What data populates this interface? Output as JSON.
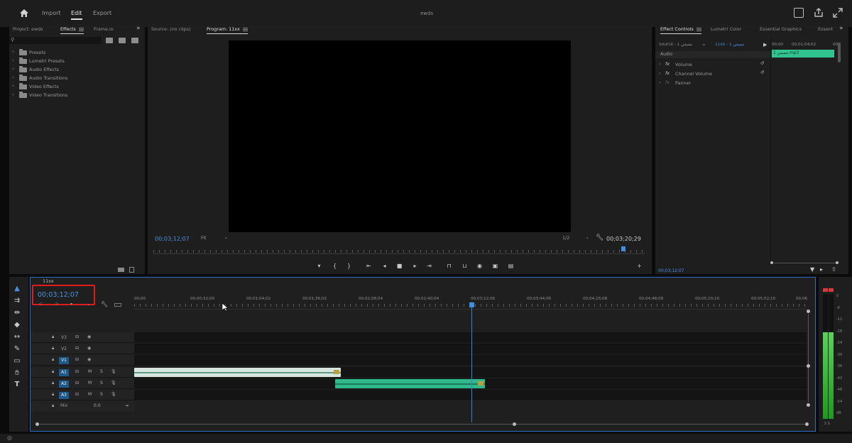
{
  "window": {
    "title": "ewds"
  },
  "menus": {
    "home_icon": "home-icon",
    "items": [
      "Import",
      "Edit",
      "Export"
    ],
    "active": "Edit"
  },
  "left_panel": {
    "tabs": [
      "Project: ewds",
      "Effects",
      "Frame.io"
    ],
    "active_tab": "Effects",
    "search_placeholder": "",
    "folders": [
      "Presets",
      "Lumetri Presets",
      "Audio Effects",
      "Audio Transitions",
      "Video Effects",
      "Video Transitions"
    ]
  },
  "monitor": {
    "tabs": [
      "Source: (no clips)",
      "Program: 11xx"
    ],
    "active_tab": "Program: 11xx",
    "timecode_current": "00;03;12;07",
    "fit_label": "Fit",
    "resolution": "1/2",
    "timecode_duration": "00;03;20;29"
  },
  "effect_controls": {
    "tabs": [
      "Effect Controls",
      "Lumetri Color",
      "Essential Graphics",
      "Essent"
    ],
    "active_tab": "Effect Controls",
    "source_label": "Source - 1 تیمپس",
    "sequence_label": "11xx - 1 تیمپس",
    "mini_tc": [
      "00;00",
      "00;01;04;02",
      "00;"
    ],
    "clip_name": "1 تیمپس.mp3",
    "section": "Audio",
    "effects": [
      "Volume",
      "Channel Volume",
      "Panner"
    ],
    "timecode": "00;03;12;07"
  },
  "timeline": {
    "sequence_name": "11xx",
    "timecode": "00;03;12;07",
    "ruler": [
      "00;00",
      "00;00;32;00",
      "00;01;04;02",
      "00;01;36;02",
      "00;02;08;04",
      "00;02;40;04",
      "00;03;12;06",
      "00;03;44;06",
      "00;04;16;08",
      "00;04;48;08",
      "00;05;20;10",
      "00;05;52;10",
      "00;06"
    ],
    "video_tracks": [
      "V3",
      "V2",
      "V1"
    ],
    "audio_tracks": [
      "A1",
      "A2",
      "A3"
    ],
    "mix": {
      "label": "Mix",
      "value": "0.0"
    },
    "playhead_fraction": 0.501,
    "clips": [
      {
        "track": "A1",
        "start": 0.0,
        "end": 0.307,
        "color": "#d8e6e0"
      },
      {
        "track": "A2",
        "start": 0.298,
        "end": 0.521,
        "color": "#2fb98a"
      }
    ]
  },
  "meter": {
    "labels": [
      "0",
      "-6",
      "-12",
      "-18",
      "-24",
      "-30",
      "-36",
      "-42",
      "-48",
      "-54",
      "dB"
    ],
    "footer": "S S"
  },
  "colors": {
    "accent": "#4a90e0",
    "selection_border": "#2b6cc4",
    "audio_clip": "#2fb98a",
    "highlight_box": "#e01b1b"
  }
}
